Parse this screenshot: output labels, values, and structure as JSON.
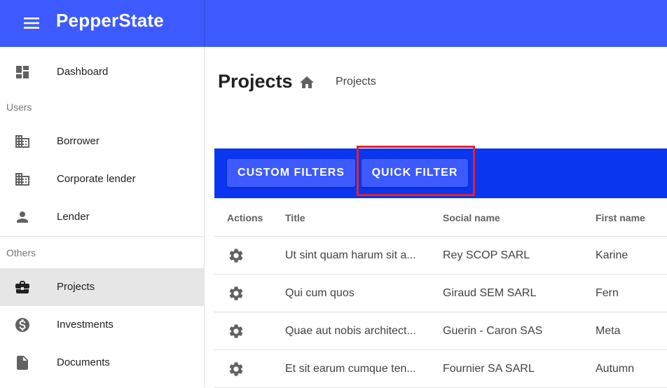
{
  "app": {
    "title": "PepperState"
  },
  "sidebar": {
    "dashboard": {
      "label": "Dashboard",
      "icon": "dashboard-icon"
    },
    "users_section": "Users",
    "borrower": {
      "label": "Borrower",
      "icon": "building-icon"
    },
    "corporate_lender": {
      "label": "Corporate lender",
      "icon": "building-icon"
    },
    "lender": {
      "label": "Lender",
      "icon": "person-icon"
    },
    "others_section": "Others",
    "projects": {
      "label": "Projects",
      "icon": "briefcase-icon",
      "active": true
    },
    "investments": {
      "label": "Investments",
      "icon": "dollar-circle-icon"
    },
    "documents": {
      "label": "Documents",
      "icon": "document-icon"
    }
  },
  "page": {
    "title": "Projects",
    "breadcrumb": "Projects"
  },
  "toolbar": {
    "custom_filters_label": "CUSTOM FILTERS",
    "quick_filter_label": "QUICK FILTER"
  },
  "table": {
    "headers": {
      "actions": "Actions",
      "title": "Title",
      "social_name": "Social name",
      "first_name": "First name"
    },
    "rows": [
      {
        "title": "Ut sint quam harum sit a...",
        "social_name": "Rey SCOP SARL",
        "first_name": "Karine"
      },
      {
        "title": "Qui cum quos",
        "social_name": "Giraud SEM SARL",
        "first_name": "Fern"
      },
      {
        "title": "Quae aut nobis architect...",
        "social_name": "Guerin - Caron SAS",
        "first_name": "Meta"
      },
      {
        "title": "Et sit earum cumque ten...",
        "social_name": "Fournier SA SARL",
        "first_name": "Autumn"
      }
    ]
  },
  "colors": {
    "appbar": "#3d5afe",
    "toolbar": "#0a36f2",
    "button": "#3d5afe",
    "highlight": "#e3242b",
    "icon": "#616161"
  }
}
